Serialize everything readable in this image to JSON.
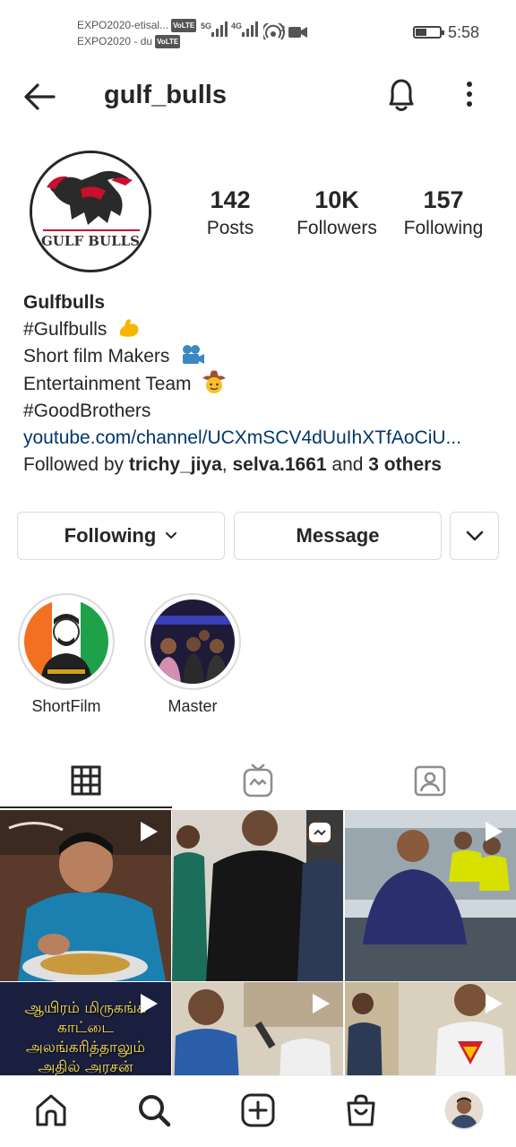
{
  "status_bar": {
    "carrier1": "EXPO2020-etisal...",
    "carrier2": "EXPO2020 - du",
    "volte": "VoLTE",
    "net1": "5G",
    "net2": "4G",
    "time": "5:58"
  },
  "header": {
    "username": "gulf_bulls"
  },
  "profile": {
    "avatar_icon": "bull-logo",
    "logo_text": "GULF BULLS",
    "stats": [
      {
        "value": "142",
        "label": "Posts"
      },
      {
        "value": "10K",
        "label": "Followers"
      },
      {
        "value": "157",
        "label": "Following"
      }
    ]
  },
  "bio": {
    "name": "Gulfbulls",
    "line1": "#Gulfbulls",
    "line2": "Short film Makers",
    "line3": "Entertainment Team",
    "line4": "#GoodBrothers",
    "link": "youtube.com/channel/UCXmSCV4dUuIhXTfAoCiU...",
    "followed_by_prefix": "Followed by ",
    "follower1": "trichy_jiya",
    "separator": ", ",
    "follower2": "selva.1661",
    "and_text": " and ",
    "others": "3 others"
  },
  "actions": {
    "following_label": "Following",
    "message_label": "Message"
  },
  "highlights": [
    {
      "label": "ShortFilm"
    },
    {
      "label": "Master"
    }
  ],
  "tabs": [
    "grid-icon",
    "igtv-icon",
    "tagged-icon"
  ],
  "grid": {
    "overlay_text": "ஆயிரம் மிருகங்க\nகாட்டை\nஅலங்கரித்தாலும்\nஅதில் அரசன்"
  },
  "bottom_nav": [
    "home-icon",
    "search-icon",
    "new-post-icon",
    "shop-icon",
    "profile-avatar"
  ],
  "colors": {
    "text": "#262626",
    "link": "#00376b",
    "border": "#dbdbdb"
  }
}
